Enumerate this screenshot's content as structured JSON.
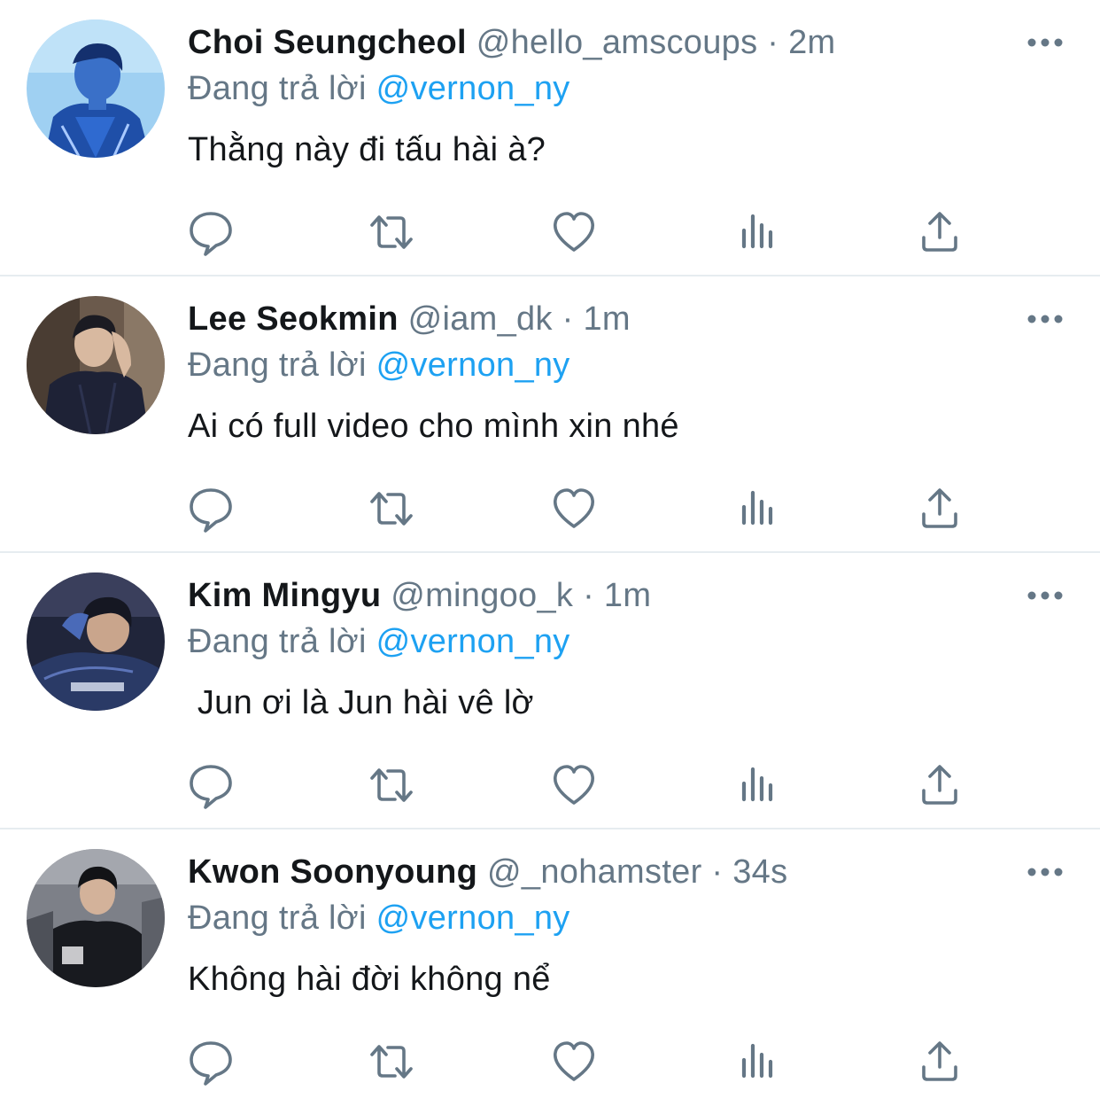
{
  "colors": {
    "text": "#14171a",
    "secondary": "#657786",
    "link": "#1da1f2",
    "divider": "#e6ecf0",
    "icon": "#657786"
  },
  "icons": {
    "reply": "speech-bubble-icon",
    "retweet": "retweet-icon",
    "like": "heart-icon",
    "stats": "bar-chart-icon",
    "share": "share-upload-icon",
    "more": "more-dots-icon"
  },
  "tweets": [
    {
      "name": "Choi Seungcheol",
      "handle": "@hello_amscoups",
      "separator": " · ",
      "time": "2m",
      "reply_prefix": "Đang trả lời ",
      "reply_to": "@vernon_ny",
      "text": "Thằng này đi tấu hài à?"
    },
    {
      "name": "Lee Seokmin",
      "handle": "@iam_dk",
      "separator": " · ",
      "time": "1m",
      "reply_prefix": "Đang trả lời ",
      "reply_to": "@vernon_ny",
      "text": "Ai có full video cho mình xin nhé"
    },
    {
      "name": "Kim Mingyu",
      "handle": "@mingoo_k",
      "separator": " · ",
      "time": "1m",
      "reply_prefix": "Đang trả lời ",
      "reply_to": "@vernon_ny",
      "text": " Jun ơi là Jun hài vê lờ"
    },
    {
      "name": "Kwon Soonyoung",
      "handle": "@_nohamster",
      "separator": " · ",
      "time": "34s",
      "reply_prefix": "Đang trả lời ",
      "reply_to": "@vernon_ny",
      "text": "Không hài đời không nể"
    }
  ]
}
